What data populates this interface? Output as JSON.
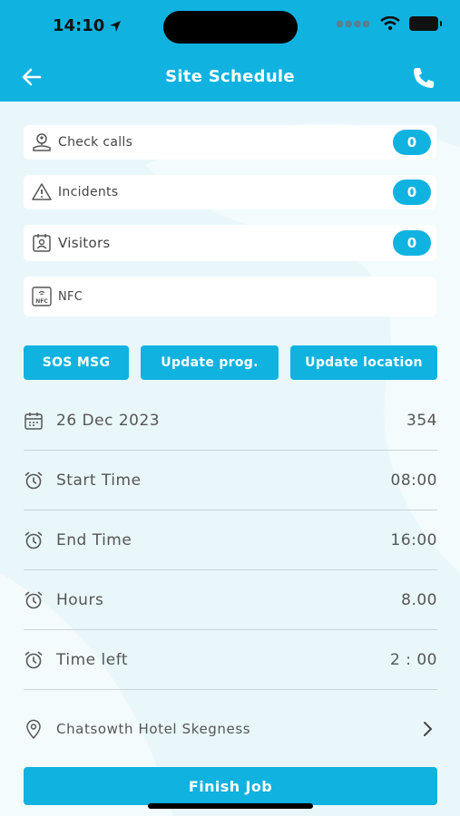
{
  "status_bar": {
    "time": "14:10"
  },
  "header": {
    "title": "Site Schedule"
  },
  "counters": [
    {
      "label": "Check calls",
      "count": "0",
      "icon": "location-person-icon"
    },
    {
      "label": "Incidents",
      "count": "0",
      "icon": "warning-icon"
    },
    {
      "label": "Visitors",
      "count": "0",
      "icon": "id-card-icon"
    }
  ],
  "nfc": {
    "label": "NFC",
    "icon": "nfc-icon"
  },
  "actions": {
    "sos_label": "SOS MSG",
    "update_progress_label": "Update prog.",
    "update_location_label": "Update location"
  },
  "schedule": {
    "date": {
      "label": "26 Dec 2023",
      "value": "354"
    },
    "start": {
      "label": "Start Time",
      "value": "08:00"
    },
    "end": {
      "label": "End Time",
      "value": "16:00"
    },
    "hours": {
      "label": "Hours",
      "value": "8.00"
    },
    "time_left": {
      "label": "Time left",
      "value": "2 : 00"
    }
  },
  "location": {
    "label": "Chatsowth Hotel Skegness"
  },
  "finish": {
    "label": "Finish Job"
  },
  "colors": {
    "accent": "#10b2e0",
    "background": "#e9f7fb",
    "divider": "#c9d3d7"
  }
}
